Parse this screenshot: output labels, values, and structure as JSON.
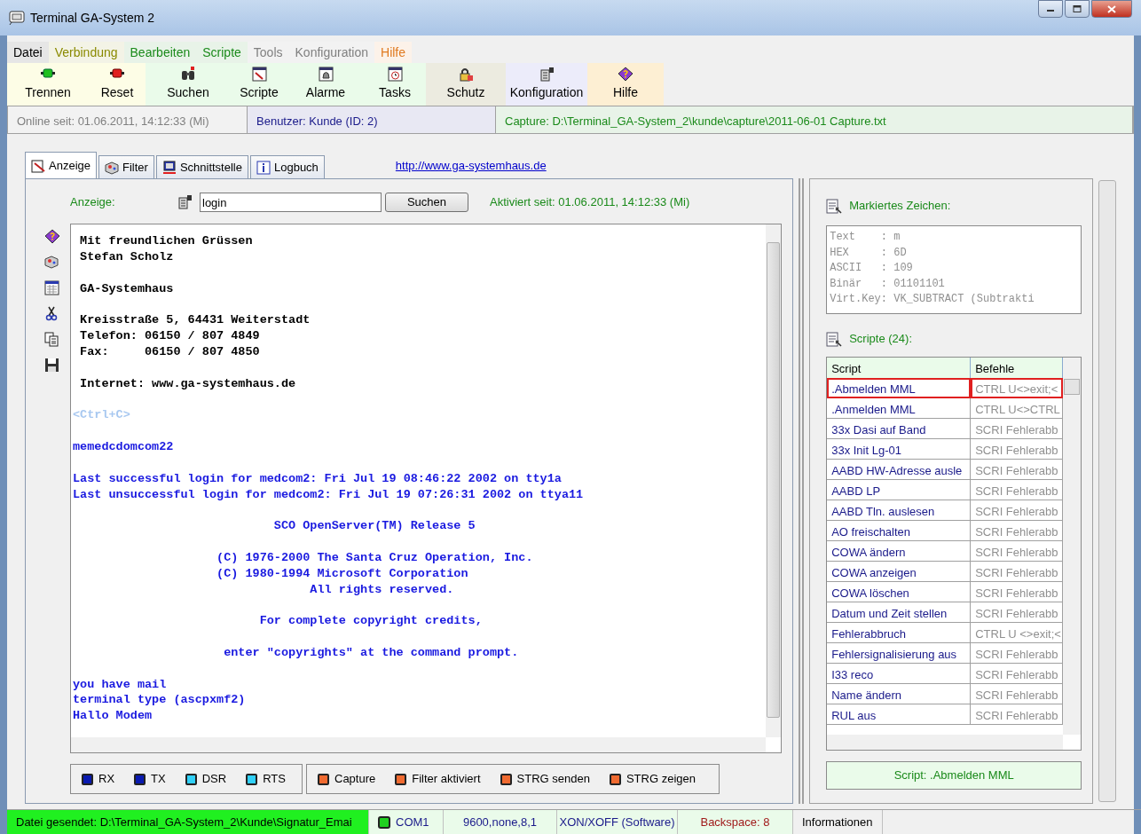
{
  "window": {
    "title": "Terminal GA-System 2"
  },
  "menu": [
    {
      "label": "Datei",
      "color": "#000000"
    },
    {
      "label": "Verbindung",
      "color": "#8a8a00"
    },
    {
      "label": "Bearbeiten",
      "color": "#1a8a1a"
    },
    {
      "label": "Scripte",
      "color": "#1a8a1a"
    },
    {
      "label": "Tools",
      "color": "#808080"
    },
    {
      "label": "Konfiguration",
      "color": "#808080"
    },
    {
      "label": "Hilfe",
      "color": "#e07a20"
    }
  ],
  "toolbar": [
    {
      "label": "Trennen",
      "color": "#fdfde6"
    },
    {
      "label": "Reset",
      "color": "#fdfde6"
    },
    {
      "label": "Suchen",
      "color": "#eafbea"
    },
    {
      "label": "Scripte",
      "color": "#eafbea"
    },
    {
      "label": "Alarme",
      "color": "#eafbea"
    },
    {
      "label": "Tasks",
      "color": "#eafbea"
    },
    {
      "label": "Schutz",
      "color": "#ecebe0"
    },
    {
      "label": "Konfiguration",
      "color": "#ececfa"
    },
    {
      "label": "Hilfe",
      "color": "#fdefd3"
    }
  ],
  "info_bar": [
    {
      "text": "Online seit: 01.06.2011, 14:12:33  (Mi)",
      "color": "#808080"
    },
    {
      "text": "Benutzer: Kunde (ID: 2)",
      "color": "#1a1a8a"
    },
    {
      "text": "Capture: D:\\Terminal_GA-System_2\\kunde\\capture\\2011-06-01 Capture.txt",
      "color": "#1a8a1a"
    }
  ],
  "tabs": [
    {
      "label": "Anzeige",
      "selected": true
    },
    {
      "label": "Filter",
      "selected": false
    },
    {
      "label": "Schnittstelle",
      "selected": false
    },
    {
      "label": "Logbuch",
      "selected": false
    }
  ],
  "link": "http://www.ga-systemhaus.de",
  "display": {
    "label": "Anzeige:",
    "search_value": "login",
    "search_button": "Suchen",
    "activated": "Aktiviert seit:  01.06.2011, 14:12:33  (Mi)"
  },
  "terminal": {
    "paragraphs": [
      [
        {
          "text": " Mit freundlichen Grüssen",
          "color": "#000000"
        },
        {
          "text": " Stefan Scholz",
          "color": "#000000"
        }
      ],
      [
        {
          "text": " GA-Systemhaus",
          "color": "#000000"
        }
      ],
      [
        {
          "text": " Kreisstraße 5, 64431 Weiterstadt",
          "color": "#000000"
        },
        {
          "text": " Telefon: 06150 / 807 4849",
          "color": "#000000"
        },
        {
          "text": " Fax:     06150 / 807 4850",
          "color": "#000000"
        }
      ],
      [
        {
          "text": " Internet: www.ga-systemhaus.de",
          "color": "#000000"
        }
      ],
      [
        {
          "text": "<Ctrl+C>",
          "color": "#a8c8f0"
        }
      ],
      [
        {
          "text": "memedcdomcom22",
          "color": "#1a1ae0"
        }
      ],
      [
        {
          "text": "Last successful login for medcom2: Fri Jul 19 08:46:22 2002 on tty1a",
          "color": "#1a1ae0"
        },
        {
          "text": "Last unsuccessful login for medcom2: Fri Jul 19 07:26:31 2002 on ttya11",
          "color": "#1a1ae0"
        }
      ],
      [
        {
          "text": "                            SCO OpenServer(TM) Release 5",
          "color": "#1a1ae0"
        }
      ],
      [
        {
          "text": "                    (C) 1976-2000 The Santa Cruz Operation, Inc.",
          "color": "#1a1ae0"
        },
        {
          "text": "                    (C) 1980-1994 Microsoft Corporation",
          "color": "#1a1ae0"
        },
        {
          "text": "                                 All rights reserved.",
          "color": "#1a1ae0"
        }
      ],
      [
        {
          "text": "                          For complete copyright credits,",
          "color": "#1a1ae0"
        }
      ],
      [
        {
          "text": "                     enter \"copyrights\" at the command prompt.",
          "color": "#1a1ae0"
        }
      ],
      [
        {
          "text": "you have mail",
          "color": "#1a1ae0"
        },
        {
          "text": "terminal type (ascpxmf2)",
          "color": "#1a1ae0"
        },
        {
          "text": "Hallo Modem",
          "color": "#1a1ae0"
        }
      ]
    ]
  },
  "signals": [
    {
      "label": "RX",
      "color": "#0a1ab0"
    },
    {
      "label": "TX",
      "color": "#0a1ab0"
    },
    {
      "label": "DSR",
      "color": "#30d0f8"
    },
    {
      "label": "RTS",
      "color": "#30d0f8"
    }
  ],
  "options": [
    {
      "label": "Capture",
      "color": "#f06a30"
    },
    {
      "label": "Filter aktiviert",
      "color": "#f06a30"
    },
    {
      "label": "STRG senden",
      "color": "#f06a30"
    },
    {
      "label": "STRG zeigen",
      "color": "#f06a30"
    }
  ],
  "marked_char": {
    "title": "Markiertes Zeichen:",
    "lines": [
      "Text    : m",
      "HEX     : 6D",
      "ASCII   : 109",
      "Binär   : 01101101",
      "Virt.Key: VK_SUBTRACT (Subtrakti"
    ]
  },
  "scripts": {
    "title": "Scripte (24):",
    "columns": [
      "Script",
      "Befehle"
    ],
    "rows": [
      {
        "name": ".Abmelden MML",
        "commands": "CTRL U<>exit;<",
        "selected": true
      },
      {
        "name": ".Anmelden MML",
        "commands": "CTRL U<>CTRL",
        "selected": false
      },
      {
        "name": "33x Dasi auf Band",
        "commands": "SCRI Fehlerabb",
        "selected": false
      },
      {
        "name": "33x Init Lg-01",
        "commands": "SCRI Fehlerabb",
        "selected": false
      },
      {
        "name": "AABD HW-Adresse ausle",
        "commands": "SCRI Fehlerabb",
        "selected": false
      },
      {
        "name": "AABD LP",
        "commands": "SCRI Fehlerabb",
        "selected": false
      },
      {
        "name": "AABD Tln. auslesen",
        "commands": "SCRI Fehlerabb",
        "selected": false
      },
      {
        "name": "AO freischalten",
        "commands": "SCRI Fehlerabb",
        "selected": false
      },
      {
        "name": "COWA ändern",
        "commands": "SCRI Fehlerabb",
        "selected": false
      },
      {
        "name": "COWA anzeigen",
        "commands": "SCRI Fehlerabb",
        "selected": false
      },
      {
        "name": "COWA löschen",
        "commands": "SCRI Fehlerabb",
        "selected": false
      },
      {
        "name": "Datum und Zeit stellen",
        "commands": "SCRI Fehlerabb",
        "selected": false
      },
      {
        "name": "Fehlerabbruch",
        "commands": "CTRL U <>exit;<",
        "selected": false
      },
      {
        "name": "Fehlersignalisierung aus",
        "commands": "SCRI Fehlerabb",
        "selected": false
      },
      {
        "name": "I33 reco",
        "commands": "SCRI Fehlerabb",
        "selected": false
      },
      {
        "name": "Name ändern",
        "commands": "SCRI Fehlerabb",
        "selected": false
      },
      {
        "name": "RUL aus",
        "commands": "SCRI Fehlerabb",
        "selected": false
      }
    ],
    "current": "Script: .Abmelden MML"
  },
  "status_bar": [
    {
      "kind": "highlight",
      "text": "Datei gesendet: D:\\Terminal_GA-System_2\\Kunde\\Signatur_Emai",
      "color": "#000000"
    },
    {
      "kind": "port",
      "text": "COM1",
      "color": "#1a1a8a"
    },
    {
      "kind": "text",
      "text": "9600,none,8,1",
      "color": "#1a1a8a"
    },
    {
      "kind": "text",
      "text": "XON/XOFF (Software)",
      "color": "#1a1a8a"
    },
    {
      "kind": "text",
      "text": "Backspace: 8",
      "color": "#a01a1a"
    },
    {
      "kind": "plain",
      "text": "Informationen",
      "color": "#000000"
    }
  ]
}
